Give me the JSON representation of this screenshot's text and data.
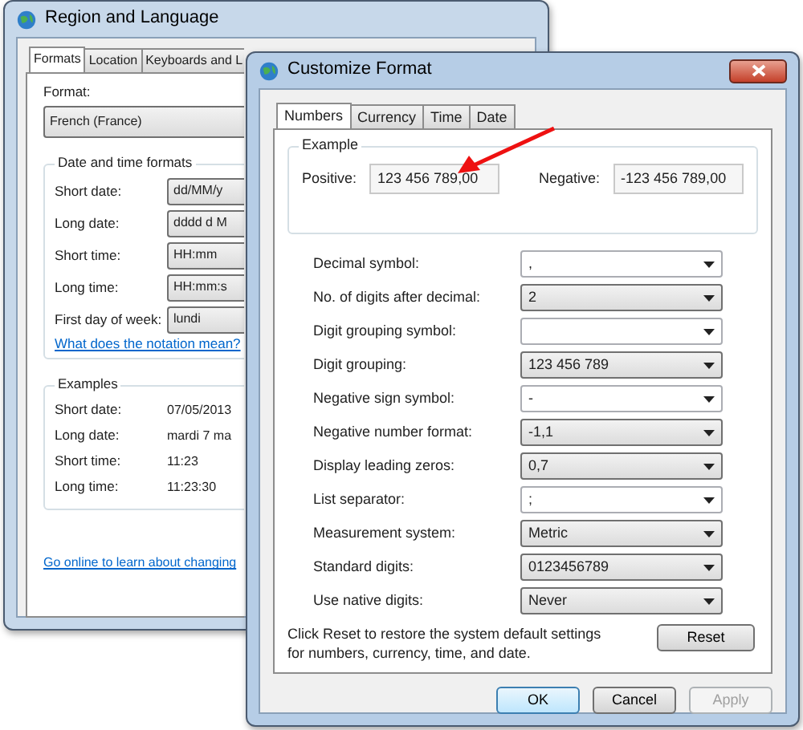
{
  "back_window": {
    "title": "Region and Language",
    "tabs": [
      {
        "label": "Formats",
        "selected": true
      },
      {
        "label": "Location",
        "selected": false
      },
      {
        "label": "Keyboards and L",
        "selected": false
      }
    ],
    "format_label": "Format:",
    "format_value": "French (France)",
    "date_time_group": {
      "title": "Date and time formats",
      "rows": [
        {
          "label": "Short date:",
          "value": "dd/MM/y"
        },
        {
          "label": "Long date:",
          "value": "dddd d M"
        },
        {
          "label": "Short time:",
          "value": "HH:mm"
        },
        {
          "label": "Long time:",
          "value": "HH:mm:s"
        },
        {
          "label": "First day of week:",
          "value": "lundi"
        }
      ]
    },
    "notation_link": "What does the notation mean?",
    "examples_group": {
      "title": "Examples",
      "rows": [
        {
          "label": "Short date:",
          "value": "07/05/2013"
        },
        {
          "label": "Long date:",
          "value": "mardi 7 ma"
        },
        {
          "label": "Short time:",
          "value": "11:23"
        },
        {
          "label": "Long time:",
          "value": "11:23:30"
        }
      ]
    },
    "online_link": "Go online to learn about changing"
  },
  "front_window": {
    "title": "Customize Format",
    "tabs": [
      {
        "label": "Numbers",
        "selected": true
      },
      {
        "label": "Currency",
        "selected": false
      },
      {
        "label": "Time",
        "selected": false
      },
      {
        "label": "Date",
        "selected": false
      }
    ],
    "example_group": {
      "title": "Example",
      "positive_label": "Positive:",
      "positive_value": "123 456 789,00",
      "negative_label": "Negative:",
      "negative_value": "-123 456 789,00"
    },
    "settings": [
      {
        "label": "Decimal symbol:",
        "value": ",",
        "kind": "editable"
      },
      {
        "label": "No. of digits after decimal:",
        "value": "2",
        "kind": "list"
      },
      {
        "label": "Digit grouping symbol:",
        "kind": "editable"
      },
      {
        "label": "Digit grouping:",
        "value": "123 456 789",
        "kind": "list"
      },
      {
        "label": "Negative sign symbol:",
        "value": "-",
        "kind": "editable"
      },
      {
        "label": "Negative number format:",
        "value": "-1,1",
        "kind": "list"
      },
      {
        "label": "Display leading zeros:",
        "value": "0,7",
        "kind": "list"
      },
      {
        "label": "List separator:",
        "value": ";",
        "kind": "editable"
      },
      {
        "label": "Measurement system:",
        "value": "Metric",
        "kind": "list"
      },
      {
        "label": "Standard digits:",
        "value": "0123456789",
        "kind": "list"
      },
      {
        "label": "Use native digits:",
        "value": "Never",
        "kind": "list"
      }
    ],
    "reset_note": "Click Reset to restore the system default settings for numbers, currency, time, and date.",
    "reset_button": "Reset",
    "buttons": [
      {
        "label": "OK",
        "kind": "default",
        "disabled": false
      },
      {
        "label": "Cancel",
        "kind": "normal",
        "disabled": false
      },
      {
        "label": "Apply",
        "kind": "normal",
        "disabled": true
      }
    ]
  }
}
